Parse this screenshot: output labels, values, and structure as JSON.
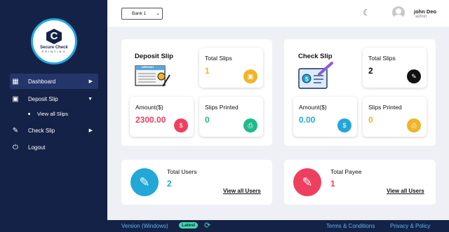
{
  "brand": {
    "name": "Secure Check",
    "sub": "PRINTING",
    "mark": "C"
  },
  "sidebar": {
    "items": [
      {
        "label": "Dashboard",
        "icon": "grid-icon"
      },
      {
        "label": "Deposit Slip",
        "icon": "deposit-icon"
      },
      {
        "label": "Check Slip",
        "icon": "edit-icon"
      },
      {
        "label": "Logout",
        "icon": "power-icon"
      }
    ],
    "sub_items": [
      {
        "label": "View all Slips"
      }
    ]
  },
  "header": {
    "bank_select": "Bank 1",
    "user_name": "john Deo",
    "user_role": "admin"
  },
  "deposit": {
    "title": "Deposit Slip",
    "slip_label": "DEPOSIT",
    "total_slips_label": "Total Slips",
    "total_slips_value": "1",
    "amount_label": "Amount($)",
    "amount_value": "2300.00",
    "printed_label": "Slips Printed",
    "printed_value": "0"
  },
  "check": {
    "title": "Check Slip",
    "total_slips_label": "Total Slips",
    "total_slips_value": "2",
    "amount_label": "Amount($)",
    "amount_value": "0.00",
    "printed_label": "Slips Printed",
    "printed_value": "0"
  },
  "users": {
    "label": "Total Users",
    "value": "2",
    "link": "View all Users"
  },
  "payee": {
    "label": "Total Payee",
    "value": "1",
    "link": "View all Users"
  },
  "footer": {
    "version": "Version (Windows)",
    "badge": "Latest",
    "terms": "Terms & Conditions",
    "privacy": "Privacy & Policy"
  },
  "colors": {
    "sidebar_bg": "#152247",
    "orange": "#f0b429",
    "red": "#ee3f60",
    "green": "#21b98a",
    "blue": "#23a7d6",
    "black": "#111111"
  }
}
